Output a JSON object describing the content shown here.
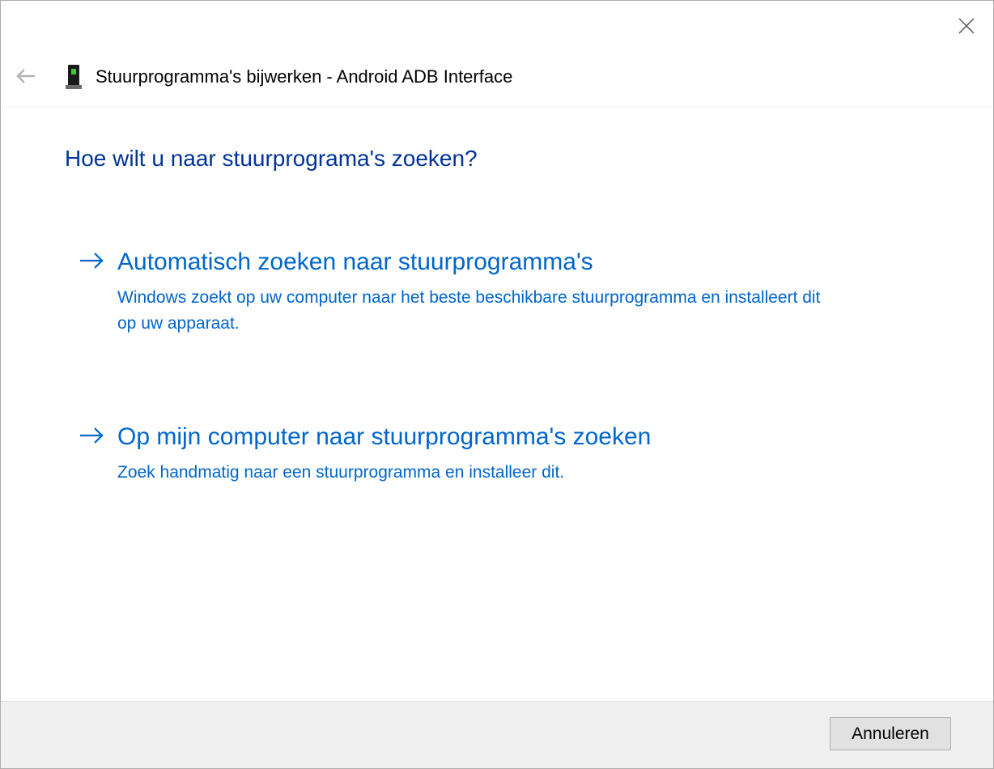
{
  "window": {
    "title": "Stuurprogramma's bijwerken - Android ADB Interface",
    "icon": "device-icon",
    "close_icon": "close-icon",
    "back_icon": "back-arrow-icon"
  },
  "main": {
    "heading": "Hoe wilt u naar stuurprograma's zoeken?",
    "options": [
      {
        "icon": "arrow-right-icon",
        "title": "Automatisch zoeken naar stuurprogramma's",
        "description": "Windows zoekt op uw computer naar het beste beschikbare stuurprogramma en installeert dit op uw apparaat."
      },
      {
        "icon": "arrow-right-icon",
        "title": "Op mijn computer naar stuurprogramma's zoeken",
        "description": "Zoek handmatig naar een stuurprogramma en installeer dit."
      }
    ]
  },
  "footer": {
    "cancel_label": "Annuleren"
  },
  "colors": {
    "heading": "#003399",
    "link": "#0066cc",
    "footer_bg": "#f0f0f0"
  }
}
